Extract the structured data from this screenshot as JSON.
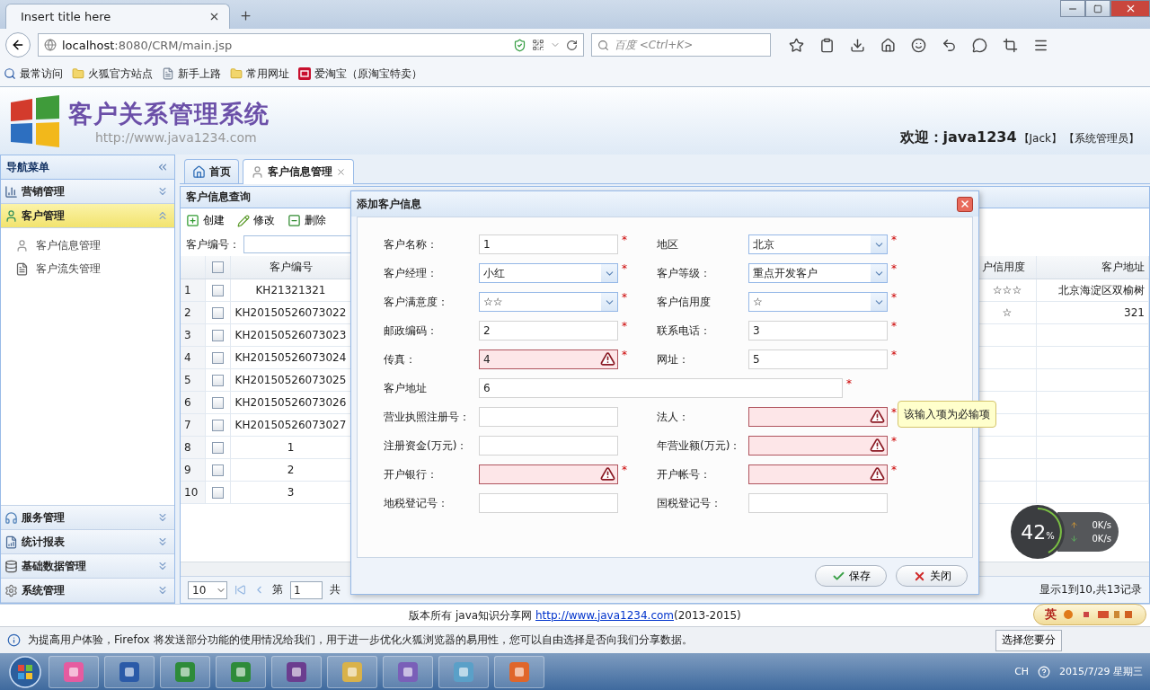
{
  "browser": {
    "tab_title": "Insert title here",
    "url_host": "localhost",
    "url_rest": ":8080/CRM/main.jsp",
    "search_placeholder": "百度 <Ctrl+K>",
    "bookmarks": [
      {
        "label": "最常访问",
        "kind": "search"
      },
      {
        "label": "火狐官方站点",
        "kind": "folder"
      },
      {
        "label": "新手上路",
        "kind": "page"
      },
      {
        "label": "常用网址",
        "kind": "folder"
      },
      {
        "label": "爱淘宝（原淘宝特卖）",
        "kind": "shop"
      }
    ]
  },
  "app": {
    "title": "客户关系管理系统",
    "site_url": "http://www.java1234.com",
    "welcome": "欢迎：java1234",
    "user": "【Jack】",
    "role": "【系统管理员】"
  },
  "sidebar": {
    "title": "导航菜单",
    "sections": [
      {
        "label": "营销管理",
        "kind": "chart",
        "expanded": false,
        "selected": false
      },
      {
        "label": "客户管理",
        "kind": "user",
        "expanded": true,
        "selected": true,
        "children": [
          {
            "label": "客户信息管理",
            "kind": "person"
          },
          {
            "label": "客户流失管理",
            "kind": "doc"
          }
        ]
      },
      {
        "label": "服务管理",
        "kind": "service",
        "expanded": false,
        "selected": false
      },
      {
        "label": "统计报表",
        "kind": "report",
        "expanded": false,
        "selected": false
      },
      {
        "label": "基础数据管理",
        "kind": "data",
        "expanded": false,
        "selected": false
      },
      {
        "label": "系统管理",
        "kind": "gear",
        "expanded": false,
        "selected": false
      }
    ]
  },
  "tabs": [
    {
      "label": "首页",
      "kind": "home",
      "selected": false,
      "closable": false
    },
    {
      "label": "客户信息管理",
      "kind": "person",
      "selected": true,
      "closable": true
    }
  ],
  "panel": {
    "title": "客户信息查询",
    "toolbar": [
      {
        "label": "创建",
        "kind": "create"
      },
      {
        "label": "修改",
        "kind": "edit"
      },
      {
        "label": "删除",
        "kind": "delete"
      }
    ],
    "search_label": "客户编号：",
    "table": {
      "header_checked": false,
      "columns": [
        "客户编号",
        "户信用度",
        "客户地址"
      ],
      "rows": [
        {
          "index": "1",
          "checked": false,
          "cells": [
            "KH21321321",
            "☆☆☆",
            "北京海淀区双榆树"
          ]
        },
        {
          "index": "2",
          "checked": false,
          "cells": [
            "KH20150526073022",
            "☆",
            "321"
          ]
        },
        {
          "index": "3",
          "checked": false,
          "cells": [
            "KH20150526073023"
          ]
        },
        {
          "index": "4",
          "checked": false,
          "cells": [
            "KH20150526073024"
          ]
        },
        {
          "index": "5",
          "checked": false,
          "cells": [
            "KH20150526073025"
          ]
        },
        {
          "index": "6",
          "checked": false,
          "cells": [
            "KH20150526073026"
          ]
        },
        {
          "index": "7",
          "checked": false,
          "cells": [
            "KH20150526073027"
          ]
        },
        {
          "index": "8",
          "checked": false,
          "cells": [
            "1"
          ]
        },
        {
          "index": "9",
          "checked": false,
          "cells": [
            "2"
          ]
        },
        {
          "index": "10",
          "checked": false,
          "cells": [
            "3"
          ]
        }
      ]
    },
    "pager": {
      "page_size": "10",
      "page_label": "第",
      "page": "1",
      "total_label": "共",
      "summary": "显示1到10,共13记录"
    }
  },
  "dialog": {
    "title": "添加客户信息",
    "rows": [
      {
        "fields": [
          {
            "label": "客户名称：",
            "value": "1",
            "kind": "text",
            "mark": "*",
            "invalid": false
          },
          {
            "label": "地区",
            "value": "北京",
            "kind": "select",
            "mark": "*",
            "invalid": false
          }
        ]
      },
      {
        "fields": [
          {
            "label": "客户经理：",
            "value": "小红",
            "kind": "select",
            "mark": "*",
            "invalid": false
          },
          {
            "label": "客户等级：",
            "value": "重点开发客户",
            "kind": "select",
            "mark": "*",
            "invalid": false
          }
        ]
      },
      {
        "fields": [
          {
            "label": "客户满意度：",
            "value": "☆☆",
            "kind": "select",
            "mark": "*",
            "invalid": false
          },
          {
            "label": "客户信用度",
            "value": "☆",
            "kind": "select",
            "mark": "*",
            "invalid": false
          }
        ]
      },
      {
        "fields": [
          {
            "label": "邮政编码：",
            "value": "2",
            "kind": "text",
            "mark": "*",
            "invalid": false
          },
          {
            "label": "联系电话：",
            "value": "3",
            "kind": "text",
            "mark": "*",
            "invalid": false
          }
        ]
      },
      {
        "fields": [
          {
            "label": "传真：",
            "value": "4",
            "kind": "text",
            "mark": "*",
            "invalid": true
          },
          {
            "label": "网址：",
            "value": "5",
            "kind": "text",
            "mark": "*",
            "invalid": false
          }
        ]
      },
      {
        "fields": [
          {
            "label": "客户地址",
            "value": "6",
            "kind": "wide",
            "mark": "*",
            "invalid": false
          }
        ]
      },
      {
        "fields": [
          {
            "label": "营业执照注册号：",
            "kind": "text",
            "invalid": false
          },
          {
            "label": "法人：",
            "kind": "text",
            "mark": "*",
            "invalid": true,
            "tooltip": "该输入项为必输项"
          }
        ]
      },
      {
        "fields": [
          {
            "label": "注册资金(万元)：",
            "kind": "text",
            "invalid": false
          },
          {
            "label": "年营业额(万元)：",
            "kind": "text",
            "mark": "*",
            "invalid": true
          }
        ]
      },
      {
        "fields": [
          {
            "label": "开户银行：",
            "kind": "text",
            "mark": "*",
            "invalid": true
          },
          {
            "label": "开户帐号：",
            "kind": "text",
            "mark": "*",
            "invalid": true
          }
        ]
      },
      {
        "fields": [
          {
            "label": "地税登记号：",
            "kind": "text",
            "invalid": false
          },
          {
            "label": "国税登记号：",
            "kind": "text",
            "invalid": false
          }
        ]
      }
    ],
    "buttons": [
      {
        "label": "保存",
        "kind": "save"
      },
      {
        "label": "关闭",
        "kind": "close"
      }
    ]
  },
  "footer": {
    "prefix": "版本所有 java知识分享网 ",
    "link": "http://www.java1234.com",
    "suffix": "(2013-2015)"
  },
  "notification": {
    "text": "为提高用户体验，Firefox 将发送部分功能的使用情况给我们，用于进一步优化火狐浏览器的易用性，您可以自由选择是否向我们分享数据。",
    "button": "选择您要分"
  },
  "net_monitor": {
    "percent": "42",
    "unit": "%",
    "up": "0K/s",
    "down": "0K/s"
  },
  "ime": {
    "mode": "英"
  },
  "taskbar": {
    "language": "CH",
    "date": "2015/7/29 星期三"
  }
}
